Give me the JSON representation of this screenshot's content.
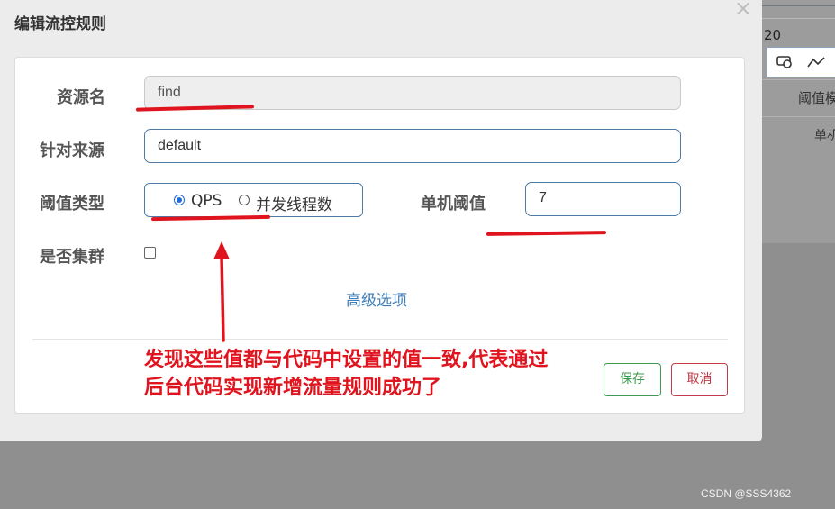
{
  "background": {
    "number": "20",
    "column_header": "阈值模",
    "cell": "单机"
  },
  "dialog": {
    "title": "编辑流控规则",
    "close_glyph": "×",
    "form": {
      "resource_name": {
        "label": "资源名",
        "value": "find"
      },
      "limit_app": {
        "label": "针对来源",
        "value": "default"
      },
      "threshold_type": {
        "label": "阈值类型",
        "options": [
          {
            "label": "QPS",
            "selected": true
          },
          {
            "label": "并发线程数",
            "selected": false
          }
        ]
      },
      "single_threshold": {
        "label": "单机阈值",
        "value": "7"
      },
      "cluster_mode": {
        "label": "是否集群",
        "checked": false
      },
      "advanced_link": "高级选项"
    },
    "buttons": {
      "save": "保存",
      "cancel": "取消"
    }
  },
  "annotation": {
    "line1": "发现这些值都与代码中设置的值一致,代表通过",
    "line2": "后台代码实现新增流量规则成功了",
    "color": "#e0141e"
  },
  "watermark": "CSDN @SSS4362",
  "icons": [
    "comment-icon",
    "line-chart-icon",
    "close-icon",
    "arrow-up-icon"
  ]
}
